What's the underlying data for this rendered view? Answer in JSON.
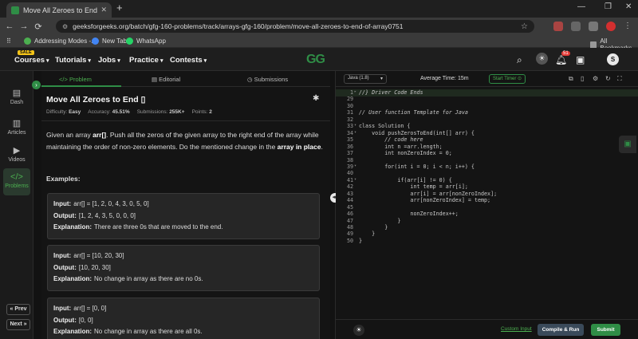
{
  "browser": {
    "tab_title": "Move All Zeroes to End | Practi",
    "tab_close": "✕",
    "new_tab": "+",
    "url": "geeksforgeeks.org/batch/gfg-160-problems/track/arrays-gfg-160/problem/move-all-zeroes-to-end-of-array0751",
    "bookmarks": [
      "Addressing Modes -...",
      "New Tab",
      "WhatsApp"
    ],
    "all_bookmarks": "All Bookmarks",
    "colors": {
      "brand": "#2f8d46"
    }
  },
  "header": {
    "sale_badge": "SALE",
    "menu": [
      "Courses",
      "Tutorials",
      "Jobs",
      "Practice",
      "Contests"
    ],
    "logo": "GG",
    "notification_count": "51",
    "avatar_initial": "S"
  },
  "rail": {
    "items": [
      {
        "label": "Dash",
        "icon": "dash-icon"
      },
      {
        "label": "Articles",
        "icon": "articles-icon"
      },
      {
        "label": "Videos",
        "icon": "videos-icon"
      },
      {
        "label": "Problems",
        "icon": "problems-icon"
      }
    ],
    "prev": "« Prev",
    "next": "Next »"
  },
  "problem": {
    "tabs": [
      "Problem",
      "Editorial",
      "Submissions"
    ],
    "title": "Move All Zeroes to End",
    "difficulty_label": "Difficulty:",
    "difficulty": "Easy",
    "accuracy_label": "Accuracy:",
    "accuracy": "45.51%",
    "submissions_label": "Submissions:",
    "submissions": "255K+",
    "points_label": "Points:",
    "points": "2",
    "desc_1": "Given an array ",
    "desc_arr": "arr[]",
    "desc_2": ". Push all the zeros of the given array to the right end of the array while maintaining the order of non-zero elements. Do the mentioned change in the ",
    "desc_place": "array in place",
    "desc_3": ".",
    "examples_label": "Examples:",
    "examples": [
      {
        "input": "arr[] = [1, 2, 0, 4, 3, 0, 5, 0]",
        "output": "[1, 2, 4, 3, 5, 0, 0, 0]",
        "explanation": "There are three 0s that are moved to the end."
      },
      {
        "input": "arr[] = [10, 20, 30]",
        "output": "[10, 20, 30]",
        "explanation": "No change in array as there are no 0s."
      },
      {
        "input": "arr[] = [0, 0]",
        "output": "[0, 0]",
        "explanation": "No change in array as there are all 0s."
      }
    ],
    "input_label": "Input:",
    "output_label": "Output:",
    "explanation_label": "Explanation:"
  },
  "editor": {
    "language": "Java (1.8)",
    "avg_time": "Average Time: 15m",
    "start_timer": "Start Timer ⊙",
    "lines": [
      {
        "n": "1",
        "code": "//} Driver Code Ends",
        "type": "comment",
        "fold": "▸"
      },
      {
        "n": "29",
        "code": "",
        "type": "code",
        "fold": ""
      },
      {
        "n": "30",
        "code": "",
        "type": "code",
        "fold": ""
      },
      {
        "n": "31",
        "code": "// User function Template for Java",
        "type": "comment",
        "fold": ""
      },
      {
        "n": "32",
        "code": "",
        "type": "code",
        "fold": ""
      },
      {
        "n": "33",
        "code": "class Solution {",
        "type": "code",
        "fold": "▾"
      },
      {
        "n": "34",
        "code": "    void pushZerosToEnd(int[] arr) {",
        "type": "code",
        "fold": "▾"
      },
      {
        "n": "35",
        "code": "        // code here",
        "type": "comment",
        "fold": ""
      },
      {
        "n": "36",
        "code": "        int n =arr.length;",
        "type": "code",
        "fold": ""
      },
      {
        "n": "37",
        "code": "        int nonZeroIndex = 0;",
        "type": "code",
        "fold": ""
      },
      {
        "n": "38",
        "code": "",
        "type": "code",
        "fold": ""
      },
      {
        "n": "39",
        "code": "        for(int i = 0; i < n; i++) {",
        "type": "code",
        "fold": "▾"
      },
      {
        "n": "40",
        "code": "",
        "type": "code",
        "fold": ""
      },
      {
        "n": "41",
        "code": "            if(arr[i] != 0) {",
        "type": "code",
        "fold": "▾"
      },
      {
        "n": "42",
        "code": "                int temp = arr[i];",
        "type": "code",
        "fold": ""
      },
      {
        "n": "43",
        "code": "                arr[i] = arr[nonZeroIndex];",
        "type": "code",
        "fold": ""
      },
      {
        "n": "44",
        "code": "                arr[nonZeroIndex] = temp;",
        "type": "code",
        "fold": ""
      },
      {
        "n": "45",
        "code": "",
        "type": "code",
        "fold": ""
      },
      {
        "n": "46",
        "code": "                nonZeroIndex++;",
        "type": "code",
        "fold": ""
      },
      {
        "n": "47",
        "code": "            }",
        "type": "code",
        "fold": ""
      },
      {
        "n": "48",
        "code": "        }",
        "type": "code",
        "fold": ""
      },
      {
        "n": "49",
        "code": "    }",
        "type": "code",
        "fold": ""
      },
      {
        "n": "50",
        "code": "}",
        "type": "code",
        "fold": ""
      }
    ],
    "custom_input": "Custom Input",
    "compile_run": "Compile & Run",
    "submit": "Submit"
  }
}
